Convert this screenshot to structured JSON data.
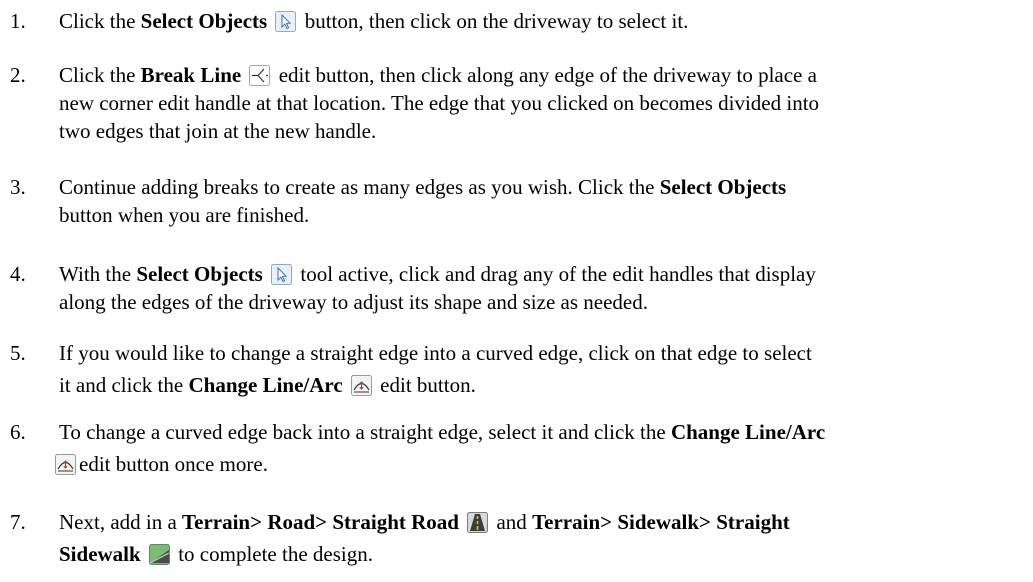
{
  "steps": [
    {
      "number": "1.",
      "lines": [
        [
          "Click the ",
          "Select Objects",
          " button, then click on the driveway to select it."
        ]
      ]
    },
    {
      "number": "2.",
      "lines": [
        [
          "Click the ",
          "Break Line",
          " edit button, then click along any edge of the driveway to place a"
        ],
        [
          "new corner edit handle at that location. The edge that you clicked on becomes divided into"
        ],
        [
          "two edges that join at the new handle."
        ]
      ]
    },
    {
      "number": "3.",
      "lines": [
        [
          "Continue adding breaks to create as many edges as you wish. Click the ",
          "Select Objects"
        ],
        [
          "button when you are finished."
        ]
      ]
    },
    {
      "number": "4.",
      "lines": [
        [
          "With the ",
          "Select Objects",
          " tool active, click and drag any of the edit handles that display"
        ],
        [
          "along the edges of the driveway to adjust its shape and size as needed."
        ]
      ]
    },
    {
      "number": "5.",
      "lines": [
        [
          "If you would like to change a straight edge into a curved edge, click on that edge to select"
        ],
        [
          "it and click the ",
          "Change Line/Arc",
          " edit button."
        ]
      ]
    },
    {
      "number": "6.",
      "lines": [
        [
          "To change a curved edge back into a straight edge, select it and click the ",
          "Change Line/Arc"
        ],
        [
          "edit button once more."
        ]
      ]
    },
    {
      "number": "7.",
      "lines": [
        [
          "Next, add in a ",
          "Terrain> Road> Straight Road",
          " and ",
          "Terrain> Sidewalk> Straight"
        ],
        [
          "Sidewalk",
          " to complete the design."
        ]
      ]
    }
  ],
  "icons": {
    "select_objects": "select-objects-icon",
    "break_line": "break-line-icon",
    "change_line_arc": "change-line-arc-icon",
    "straight_road": "straight-road-icon",
    "straight_sidewalk": "straight-sidewalk-icon"
  },
  "colors": {
    "icon_border": "#8fa9c9",
    "icon_bg": "#e8f0fa",
    "arrow_blue": "#3d6db5",
    "road_yellow": "#e8c21a",
    "sidewalk_green": "#7fb97a"
  }
}
